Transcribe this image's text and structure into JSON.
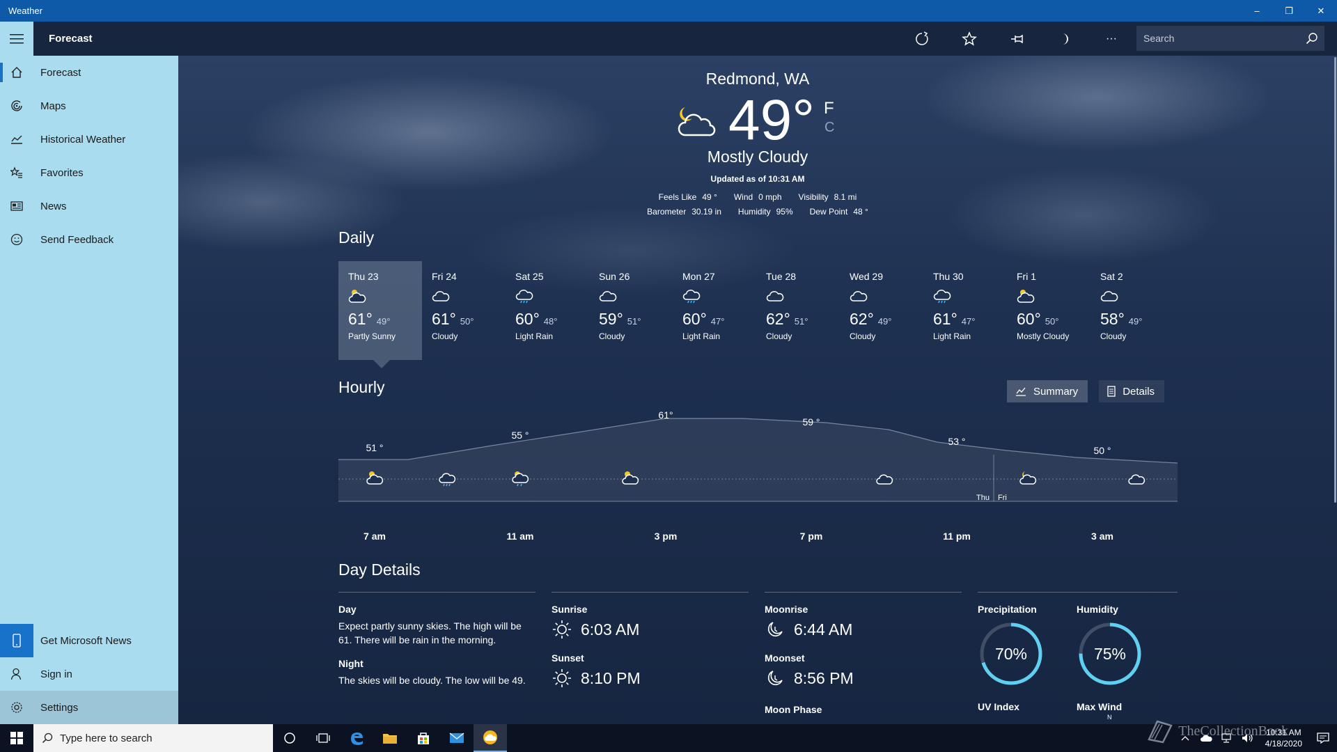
{
  "window": {
    "title": "Weather",
    "minimize": "–",
    "restore": "❐",
    "close": "✕"
  },
  "header": {
    "section_title": "Forecast",
    "search_placeholder": "Search",
    "more": "···"
  },
  "sidebar": {
    "items": [
      {
        "label": "Forecast",
        "icon": "home-icon"
      },
      {
        "label": "Maps",
        "icon": "radar-icon"
      },
      {
        "label": "Historical Weather",
        "icon": "chart-icon"
      },
      {
        "label": "Favorites",
        "icon": "favorites-icon"
      },
      {
        "label": "News",
        "icon": "news-icon"
      },
      {
        "label": "Send Feedback",
        "icon": "smiley-icon"
      }
    ],
    "bottom": [
      {
        "label": "Get Microsoft News",
        "icon": "phone-icon"
      },
      {
        "label": "Sign in",
        "icon": "person-icon"
      },
      {
        "label": "Settings",
        "icon": "gear-icon"
      }
    ]
  },
  "current": {
    "location": "Redmond, WA",
    "temp": "49°",
    "unit_f": "F",
    "unit_c": "C",
    "condition": "Mostly Cloudy",
    "updated": "Updated as of 10:31 AM",
    "stats_row1": [
      {
        "label": "Feels Like",
        "value": "49 °"
      },
      {
        "label": "Wind",
        "value": "0 mph"
      },
      {
        "label": "Visibility",
        "value": "8.1 mi"
      }
    ],
    "stats_row2": [
      {
        "label": "Barometer",
        "value": "30.19 in"
      },
      {
        "label": "Humidity",
        "value": "95%"
      },
      {
        "label": "Dew Point",
        "value": "48 °"
      }
    ]
  },
  "daily": {
    "title": "Daily",
    "days": [
      {
        "name": "Thu 23",
        "hi": "61°",
        "lo": "49°",
        "cond": "Partly Sunny",
        "icon": "partly-sunny"
      },
      {
        "name": "Fri 24",
        "hi": "61°",
        "lo": "50°",
        "cond": "Cloudy",
        "icon": "cloudy"
      },
      {
        "name": "Sat 25",
        "hi": "60°",
        "lo": "48°",
        "cond": "Light Rain",
        "icon": "rain"
      },
      {
        "name": "Sun 26",
        "hi": "59°",
        "lo": "51°",
        "cond": "Cloudy",
        "icon": "cloudy"
      },
      {
        "name": "Mon 27",
        "hi": "60°",
        "lo": "47°",
        "cond": "Light Rain",
        "icon": "rain"
      },
      {
        "name": "Tue 28",
        "hi": "62°",
        "lo": "51°",
        "cond": "Cloudy",
        "icon": "cloudy"
      },
      {
        "name": "Wed 29",
        "hi": "62°",
        "lo": "49°",
        "cond": "Cloudy",
        "icon": "cloudy"
      },
      {
        "name": "Thu 30",
        "hi": "61°",
        "lo": "47°",
        "cond": "Light Rain",
        "icon": "rain"
      },
      {
        "name": "Fri 1",
        "hi": "60°",
        "lo": "50°",
        "cond": "Mostly Cloudy",
        "icon": "partly-sunny"
      },
      {
        "name": "Sat 2",
        "hi": "58°",
        "lo": "49°",
        "cond": "Cloudy",
        "icon": "cloudy"
      }
    ]
  },
  "hourly": {
    "title": "Hourly",
    "summary_label": "Summary",
    "details_label": "Details",
    "time_labels": [
      "7 am",
      "11 am",
      "3 pm",
      "7 pm",
      "11 pm",
      "3 am"
    ],
    "temp_labels": [
      "51 °",
      "55 °",
      "61°",
      "59 °",
      "53 °",
      "50 °"
    ],
    "day_divider": [
      "Thu",
      "Fri"
    ]
  },
  "day_details": {
    "title": "Day Details",
    "day_label": "Day",
    "day_text": "Expect partly sunny skies. The high will be 61. There will be rain in the morning.",
    "night_label": "Night",
    "night_text": "The skies will be cloudy. The low will be 49.",
    "sunrise_label": "Sunrise",
    "sunrise": "6:03 AM",
    "sunset_label": "Sunset",
    "sunset": "8:10 PM",
    "moonrise_label": "Moonrise",
    "moonrise": "6:44 AM",
    "moonset_label": "Moonset",
    "moonset": "8:56 PM",
    "moon_phase_label": "Moon Phase",
    "precipitation_label": "Precipitation",
    "precipitation": "70%",
    "precipitation_pct": 70,
    "humidity_label": "Humidity",
    "humidity": "75%",
    "humidity_pct": 75,
    "uv_label": "UV Index",
    "wind_label": "Max Wind",
    "wind_compass": "N"
  },
  "taskbar": {
    "search_placeholder": "Type here to search",
    "time": "10:31 AM",
    "date": "4/18/2020",
    "watermark": "TheCollectionBook"
  },
  "colors": {
    "accent": "#1872c8",
    "sidebar": "#a9dcef",
    "gauge": "#5fd0f2",
    "titlebar": "#0f5aa8"
  }
}
